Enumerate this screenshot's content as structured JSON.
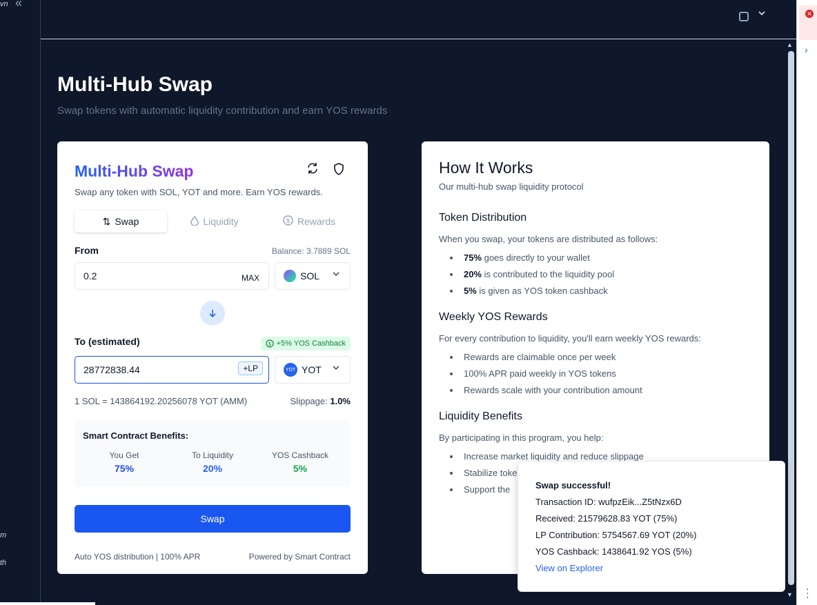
{
  "sidebar": {
    "frag_top": "vn",
    "frag_mid": "m",
    "frag_bottom": "th"
  },
  "header": {
    "title": "Multi-Hub Swap",
    "subtitle": "Swap tokens with automatic liquidity contribution and earn YOS rewards"
  },
  "swap_card": {
    "title": "Multi-Hub Swap",
    "subtitle": "Swap any token with SOL, YOT and more. Earn YOS rewards.",
    "tabs": [
      {
        "label": "Swap",
        "icon": "swap-arrows-icon"
      },
      {
        "label": "Liquidity",
        "icon": "droplet-icon"
      },
      {
        "label": "Rewards",
        "icon": "dollar-coin-icon"
      }
    ],
    "from": {
      "label": "From",
      "balance": "Balance: 3.7889 SOL",
      "value": "0.2",
      "max_label": "MAX",
      "token": "SOL"
    },
    "to": {
      "label": "To (estimated)",
      "cashback_badge": "+5% YOS Cashback",
      "value": "28772838.44",
      "lp_badge": "+LP",
      "token": "YOT",
      "token_icon_text": "YOT"
    },
    "rate": "1 SOL = 143864192.20256078 YOT (AMM)",
    "slippage_label": "Slippage:",
    "slippage_value": "1.0%",
    "benefits": {
      "title": "Smart Contract Benefits:",
      "items": [
        {
          "label": "You Get",
          "value": "75%"
        },
        {
          "label": "To Liquidity",
          "value": "20%"
        },
        {
          "label": "YOS Cashback",
          "value": "5%"
        }
      ]
    },
    "swap_button": "Swap",
    "footer_left": "Auto YOS distribution | 100% APR",
    "footer_right": "Powered by Smart Contract"
  },
  "how_card": {
    "title": "How It Works",
    "subtitle": "Our multi-hub swap liquidity protocol",
    "sections": [
      {
        "title": "Token Distribution",
        "desc": "When you swap, your tokens are distributed as follows:",
        "items": [
          {
            "bold": "75%",
            "text": " goes directly to your wallet"
          },
          {
            "bold": "20%",
            "text": " is contributed to the liquidity pool"
          },
          {
            "bold": "5%",
            "text": " is given as YOS token cashback"
          }
        ]
      },
      {
        "title": "Weekly YOS Rewards",
        "desc": "For every contribution to liquidity, you'll earn weekly YOS rewards:",
        "items": [
          {
            "bold": "",
            "text": "Rewards are claimable once per week"
          },
          {
            "bold": "",
            "text": "100% APR paid weekly in YOS tokens"
          },
          {
            "bold": "",
            "text": "Rewards scale with your contribution amount"
          }
        ]
      },
      {
        "title": "Liquidity Benefits",
        "desc": "By participating in this program, you help:",
        "items": [
          {
            "bold": "",
            "text": "Increase market liquidity and reduce slippage"
          },
          {
            "bold": "",
            "text": "Stabilize toke"
          },
          {
            "bold": "",
            "text": "Support the"
          }
        ]
      }
    ]
  },
  "toast": {
    "title": "Swap successful!",
    "tx": "Transaction ID: wufpzEik...Z5tNzx6D",
    "received": "Received: 21579628.83 YOT (75%)",
    "lp": "LP Contribution: 5754567.69 YOT (20%)",
    "cashback": "YOS Cashback: 1438641.92 YOS (5%)",
    "link": "View on Explorer"
  },
  "colors": {
    "accent": "#1a56f0",
    "background": "#0f172a",
    "cashback_green": "#16a34a"
  }
}
